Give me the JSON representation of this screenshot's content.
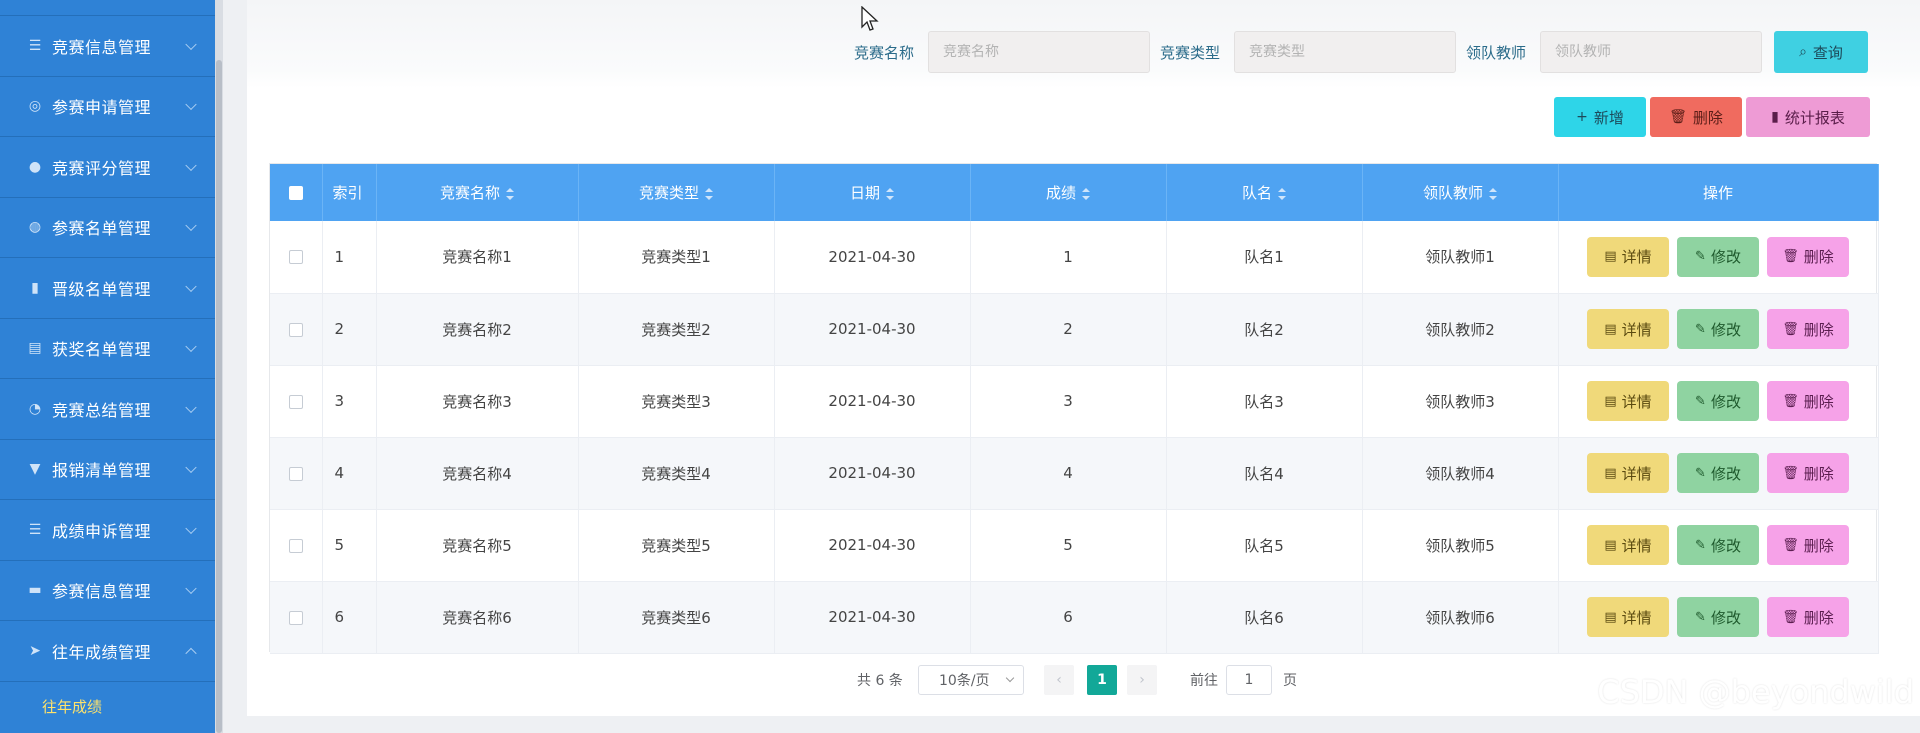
{
  "sidebar": {
    "items": [
      {
        "label": "竞赛信息管理",
        "icon": "list-icon",
        "glyph": "☰"
      },
      {
        "label": "参赛申请管理",
        "icon": "target-icon",
        "glyph": "◎"
      },
      {
        "label": "竞赛评分管理",
        "icon": "location-pin-icon",
        "glyph": "●"
      },
      {
        "label": "参赛名单管理",
        "icon": "globe-icon",
        "glyph": "◍"
      },
      {
        "label": "晋级名单管理",
        "icon": "bar-chart-icon",
        "glyph": "▮"
      },
      {
        "label": "获奖名单管理",
        "icon": "clipboard-icon",
        "glyph": "▤"
      },
      {
        "label": "竞赛总结管理",
        "icon": "clock-icon",
        "glyph": "◔"
      },
      {
        "label": "报销清单管理",
        "icon": "hand-icon",
        "glyph": "▼"
      },
      {
        "label": "成绩申诉管理",
        "icon": "list-icon",
        "glyph": "☰"
      },
      {
        "label": "参赛信息管理",
        "icon": "monitor-icon",
        "glyph": "▬"
      },
      {
        "label": "往年成绩管理",
        "icon": "send-icon",
        "glyph": "➤"
      }
    ],
    "submenu": {
      "label": "往年成绩"
    }
  },
  "search": {
    "name_label": "竞赛名称",
    "name_placeholder": "竞赛名称",
    "type_label": "竞赛类型",
    "type_placeholder": "竞赛类型",
    "teacher_label": "领队教师",
    "teacher_placeholder": "领队教师",
    "query_label": "查询"
  },
  "toolbar": {
    "add_label": "新增",
    "delete_label": "删除",
    "stats_label": "统计报表"
  },
  "table": {
    "headers": [
      "索引",
      "竞赛名称",
      "竞赛类型",
      "日期",
      "成绩",
      "队名",
      "领队教师",
      "操作"
    ],
    "rows": [
      [
        "1",
        "竞赛名称1",
        "竞赛类型1",
        "2021-04-30",
        "1",
        "队名1",
        "领队教师1"
      ],
      [
        "2",
        "竞赛名称2",
        "竞赛类型2",
        "2021-04-30",
        "2",
        "队名2",
        "领队教师2"
      ],
      [
        "3",
        "竞赛名称3",
        "竞赛类型3",
        "2021-04-30",
        "3",
        "队名3",
        "领队教师3"
      ],
      [
        "4",
        "竞赛名称4",
        "竞赛类型4",
        "2021-04-30",
        "4",
        "队名4",
        "领队教师4"
      ],
      [
        "5",
        "竞赛名称5",
        "竞赛类型5",
        "2021-04-30",
        "5",
        "队名5",
        "领队教师5"
      ],
      [
        "6",
        "竞赛名称6",
        "竞赛类型6",
        "2021-04-30",
        "6",
        "队名6",
        "领队教师6"
      ]
    ],
    "actions": {
      "detail": "详情",
      "edit": "修改",
      "delete": "删除"
    }
  },
  "pagination": {
    "total": "共 6 条",
    "page_size": "10条/页",
    "current": "1",
    "goto_label": "前往",
    "jump_value": "1",
    "page_suffix": "页"
  },
  "watermark": "CSDN @beyondwild"
}
